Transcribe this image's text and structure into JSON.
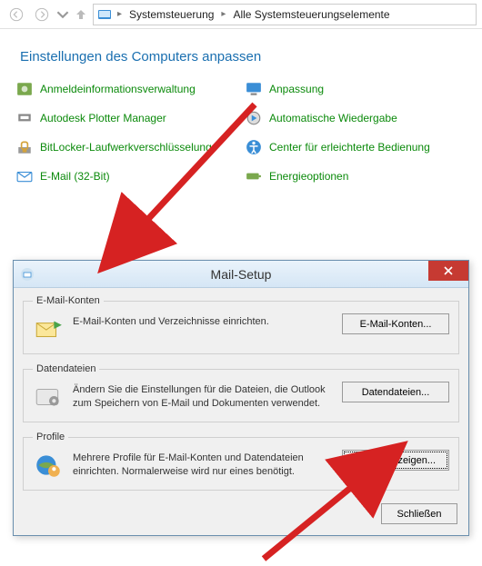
{
  "breadcrumb": {
    "seg1": "Systemsteuerung",
    "seg2": "Alle Systemsteuerungselemente"
  },
  "heading": "Einstellungen des Computers anpassen",
  "cp": {
    "items": [
      {
        "label": "Anmeldeinformationsverwaltung"
      },
      {
        "label": "Anpassung"
      },
      {
        "label": "Autodesk Plotter Manager"
      },
      {
        "label": "Automatische Wiedergabe"
      },
      {
        "label": "BitLocker-Laufwerkverschlüsselung"
      },
      {
        "label": "Center für erleichterte Bedienung"
      },
      {
        "label": "E-Mail (32-Bit)"
      },
      {
        "label": "Energieoptionen"
      }
    ]
  },
  "dialog": {
    "title": "Mail-Setup",
    "groups": {
      "email": {
        "legend": "E-Mail-Konten",
        "text": "E-Mail-Konten und Verzeichnisse einrichten.",
        "button": "E-Mail-Konten..."
      },
      "data": {
        "legend": "Datendateien",
        "text": "Ändern Sie die Einstellungen für die Dateien, die Outlook zum Speichern von E-Mail und Dokumenten verwendet.",
        "button": "Datendateien..."
      },
      "profile": {
        "legend": "Profile",
        "text": "Mehrere Profile für E-Mail-Konten und Datendateien einrichten. Normalerweise wird nur eines benötigt.",
        "button": "Profile anzeigen..."
      }
    },
    "close_label": "Schließen"
  }
}
